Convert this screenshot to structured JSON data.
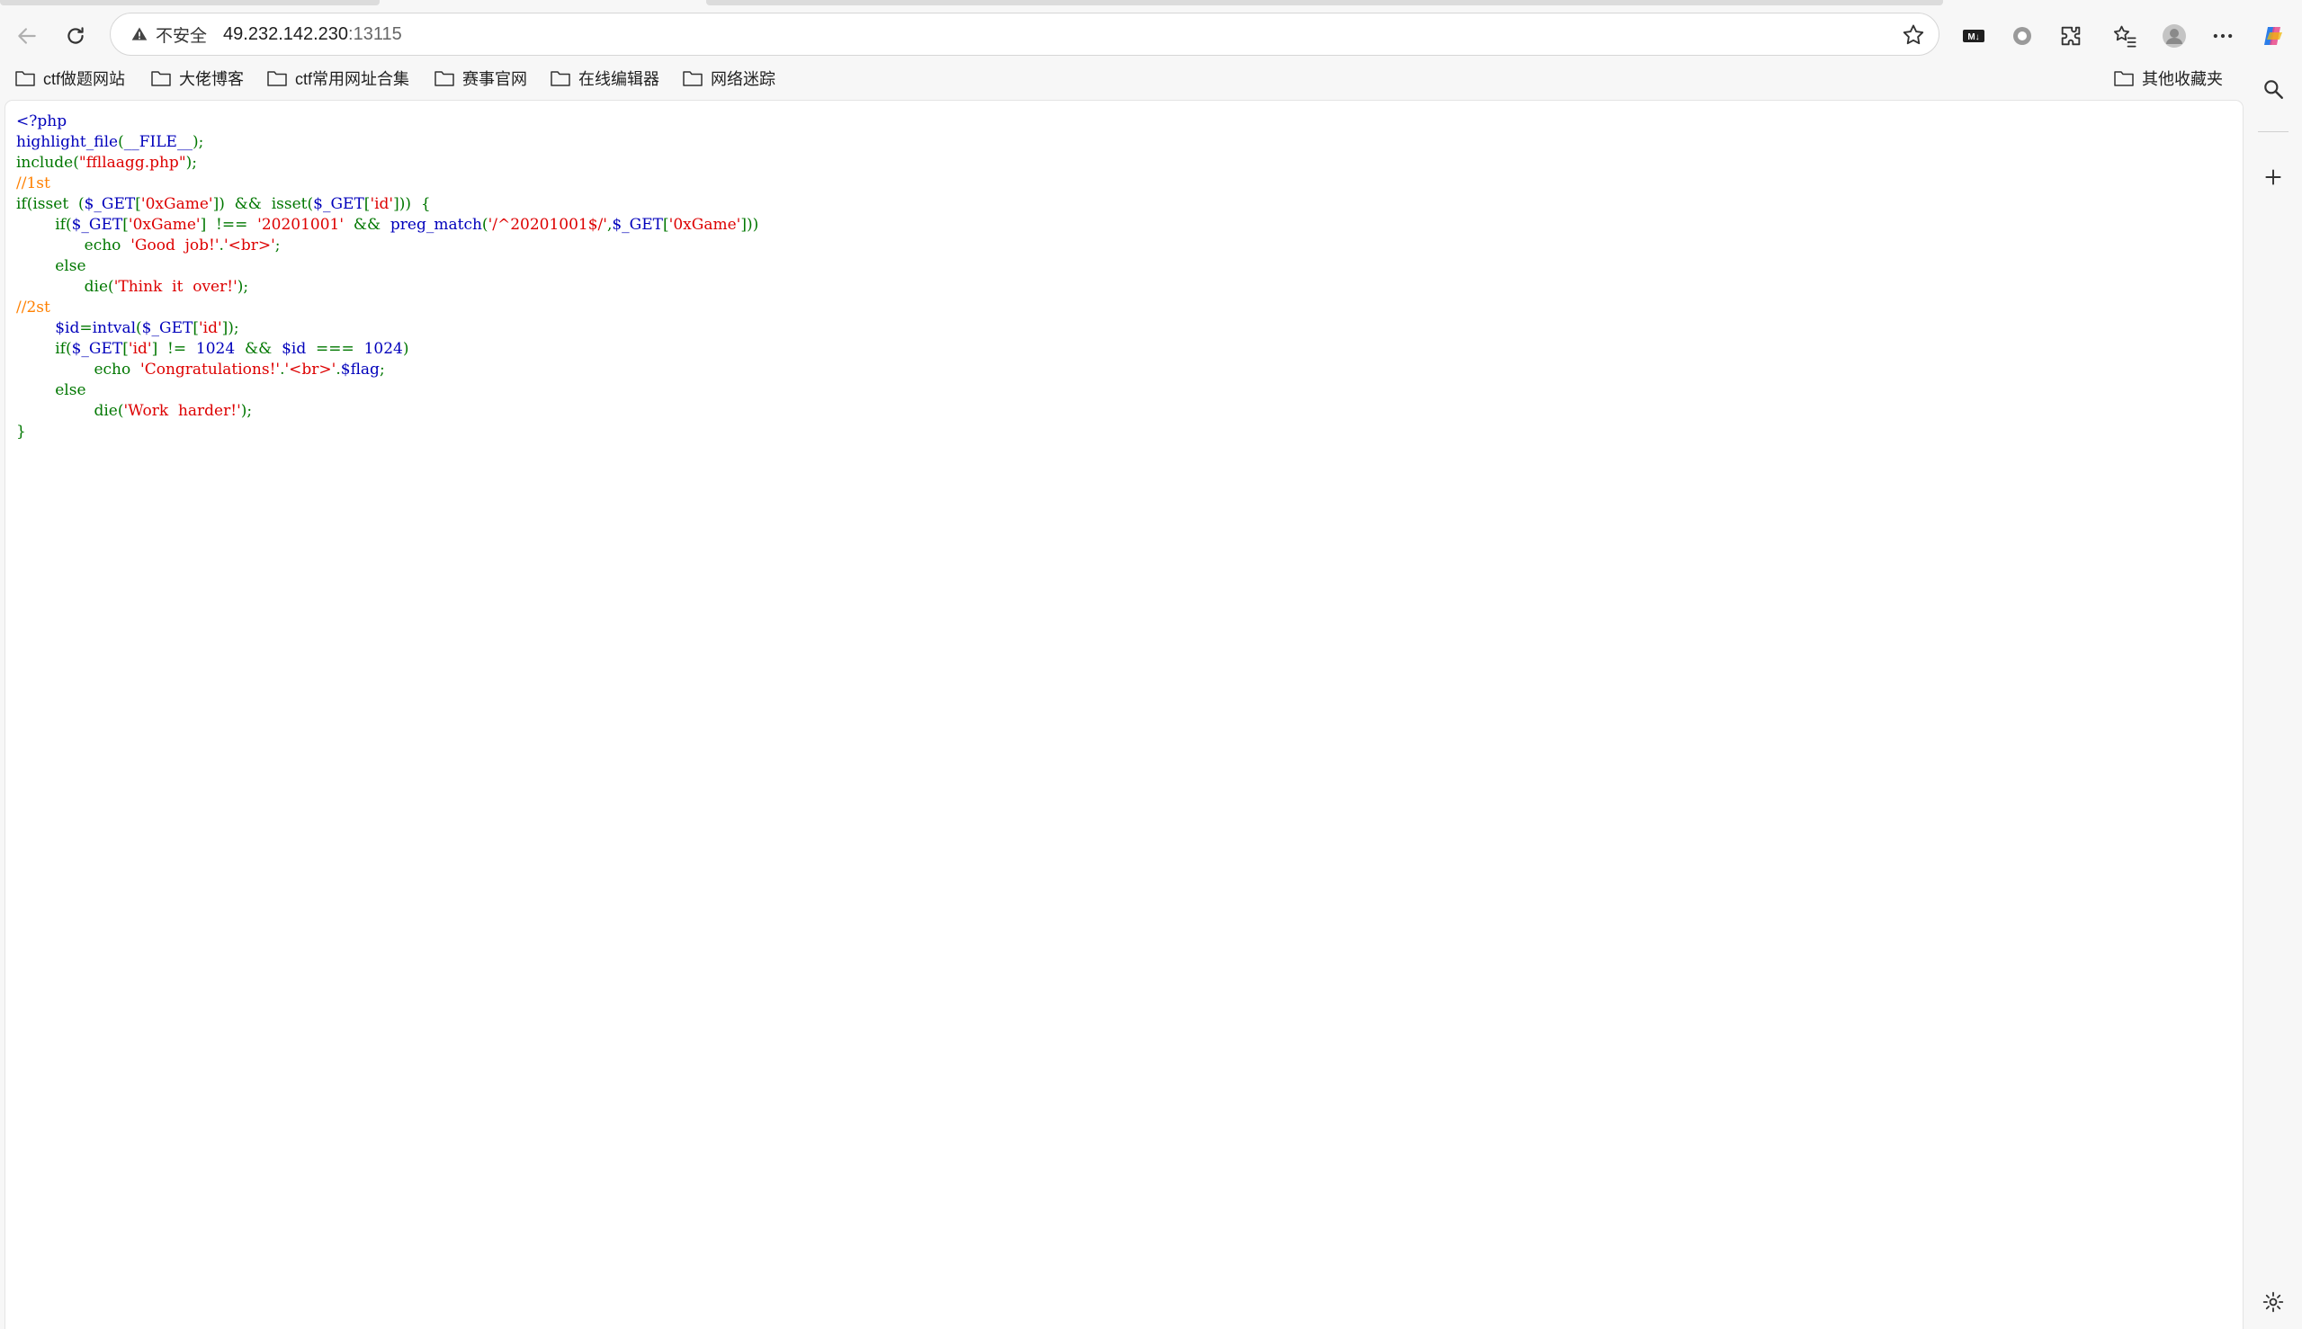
{
  "browser": {
    "address_bar": {
      "security_label": "不安全",
      "url_host": "49.232.142.230",
      "url_port": ":13115"
    },
    "toolbar_icons": [
      "back-icon",
      "refresh-icon",
      "star-icon",
      "markdown-icon",
      "record-icon",
      "extensions-icon",
      "favorites-icon",
      "profile-icon",
      "more-icon",
      "copilot-icon"
    ],
    "markdown_badge": "M↓"
  },
  "bookmarks": {
    "items": [
      {
        "label": "ctf做题网站"
      },
      {
        "label": "大佬博客"
      },
      {
        "label": "ctf常用网址合集"
      },
      {
        "label": "赛事官网"
      },
      {
        "label": "在线编辑器"
      },
      {
        "label": "网络迷踪"
      }
    ],
    "other_label": "其他收藏夹"
  },
  "page": {
    "code_lines": [
      "<?php",
      "highlight_file(__FILE__);",
      "include(\"ffllaagg.php\");",
      "//1st",
      "if(isset  ($_GET['0xGame'])  &&  isset($_GET['id']))  {",
      "        if($_GET['0xGame']  !==  '20201001'  &&  preg_match('/^20201001$/',$_GET['0xGame']))",
      "              echo  'Good  job!'.'<br>';",
      "        else",
      "              die('Think  it  over!');",
      "//2st",
      "        $id=intval($_GET['id']);",
      "        if($_GET['id']  !=  1024  &&  $id  ===  1024)",
      "                echo  'Congratulations!'.'<br>'.$flag;",
      "        else",
      "                die('Work  harder!');",
      "}"
    ]
  },
  "sidebar": {
    "icons": [
      "search-icon",
      "add-icon",
      "settings-icon"
    ]
  },
  "colors": {
    "php_default": "#0000BB",
    "php_keyword": "#007700",
    "php_string": "#DD0000",
    "php_comment": "#FF8000"
  }
}
